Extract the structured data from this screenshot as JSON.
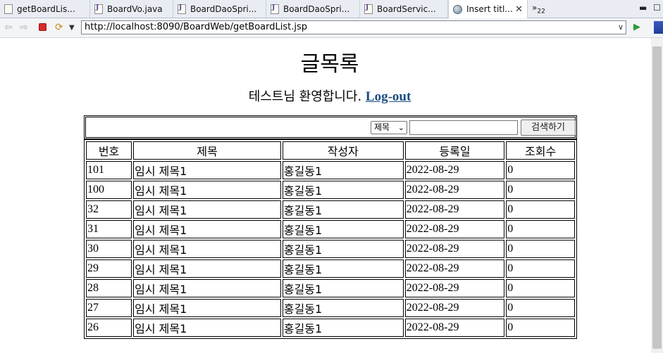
{
  "tabs": [
    {
      "label": "getBoardLis...",
      "icon": "file-icon"
    },
    {
      "label": "BoardVo.java",
      "icon": "java-file-icon"
    },
    {
      "label": "BoardDaoSpri...",
      "icon": "java-file-icon"
    },
    {
      "label": "BoardDaoSpri...",
      "icon": "java-file-icon"
    },
    {
      "label": "BoardServic...",
      "icon": "java-file-icon"
    },
    {
      "label": "Insert titl...",
      "icon": "globe-icon",
      "active": true
    }
  ],
  "overflow_count": "22",
  "url": "http://localhost:8090/BoardWeb/getBoardList.jsp",
  "page": {
    "title": "글목록",
    "welcome": "테스트님 환영합니다.",
    "logout": "Log-out"
  },
  "search": {
    "condition": "제목",
    "keyword": "",
    "button": "검색하기"
  },
  "table": {
    "headers": [
      "번호",
      "제목",
      "작성자",
      "등록일",
      "조회수"
    ],
    "rows": [
      [
        "101",
        "임시 제목1",
        "홍길동1",
        "2022-08-29",
        "0"
      ],
      [
        "100",
        "임시 제목1",
        "홍길동1",
        "2022-08-29",
        "0"
      ],
      [
        "32",
        "임시 제목1",
        "홍길동1",
        "2022-08-29",
        "0"
      ],
      [
        "31",
        "임시 제목1",
        "홍길동1",
        "2022-08-29",
        "0"
      ],
      [
        "30",
        "임시 제목1",
        "홍길동1",
        "2022-08-29",
        "0"
      ],
      [
        "29",
        "임시 제목1",
        "홍길동1",
        "2022-08-29",
        "0"
      ],
      [
        "28",
        "임시 제목1",
        "홍길동1",
        "2022-08-29",
        "0"
      ],
      [
        "27",
        "임시 제목1",
        "홍길동1",
        "2022-08-29",
        "0"
      ],
      [
        "26",
        "임시 제목1",
        "홍길동1",
        "2022-08-29",
        "0"
      ]
    ]
  }
}
